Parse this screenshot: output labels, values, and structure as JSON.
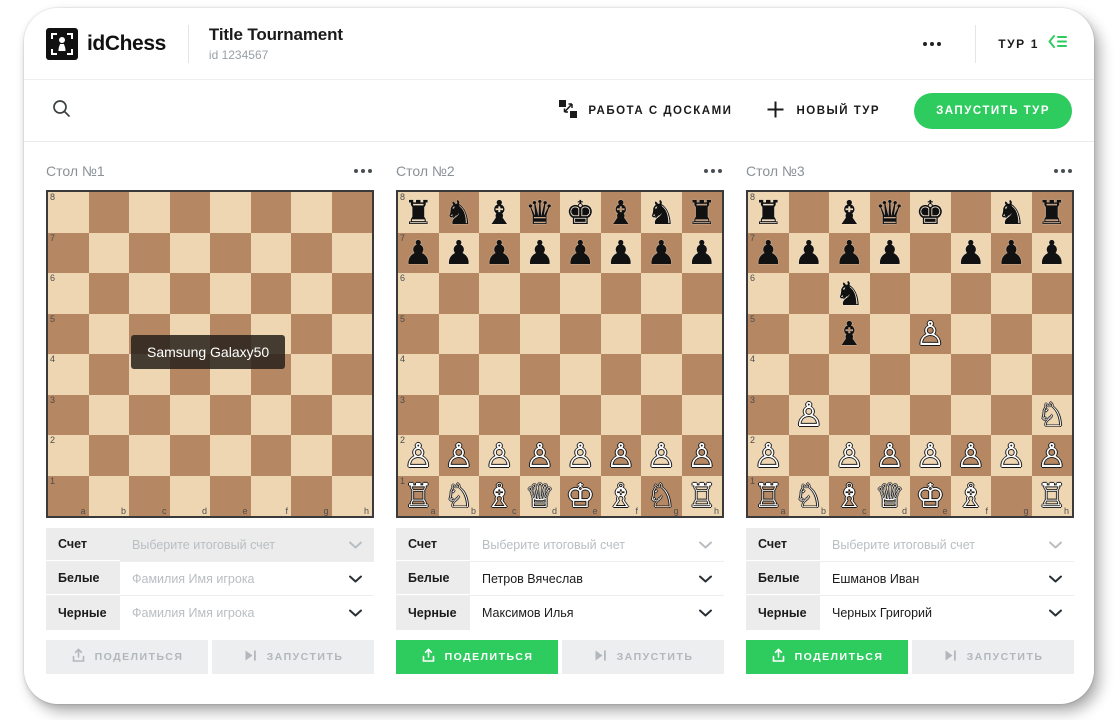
{
  "header": {
    "brand_name": "idChess",
    "brand_icon": "chess-pawn-logo-icon",
    "tournament_title": "Title Tournament",
    "tournament_id": "id 1234567",
    "more_icon": "more-horizontal-icon",
    "round_label": "ТУР 1",
    "round_icon": "round-list-icon"
  },
  "toolbar": {
    "search_icon": "search-icon",
    "boards_icon": "boards-work-icon",
    "boards_label": "РАБОТА С ДОСКАМИ",
    "plus_icon": "plus-icon",
    "new_round_label": "НОВЫЙ ТУР",
    "start_round_label": "ЗАПУСТИТЬ ТУР"
  },
  "colors": {
    "accent_green": "#2ecc5f",
    "board_light": "#eed6b3",
    "board_dark": "#b58863",
    "label_bg": "#ececec",
    "disabled_text": "#b2b7bb"
  },
  "labels": {
    "score": "Счет",
    "white": "Белые",
    "black": "Черные",
    "score_placeholder": "Выберите итоговый счет",
    "player_placeholder": "Фамилия Имя игрока",
    "share": "ПОДЕЛИТЬСЯ",
    "launch": "ЗАПУСТИТЬ",
    "share_icon": "share-upload-icon",
    "launch_icon": "play-to-end-icon",
    "chevron_icon": "chevron-down-icon",
    "more_icon": "more-horizontal-icon"
  },
  "board_coords": {
    "files": [
      "a",
      "b",
      "c",
      "d",
      "e",
      "f",
      "g",
      "h"
    ],
    "ranks": [
      "8",
      "7",
      "6",
      "5",
      "4",
      "3",
      "2",
      "1"
    ]
  },
  "cards": [
    {
      "title": "Стол №1",
      "tooltip": "Samsung Galaxy50",
      "score_value": "",
      "white_value": "",
      "black_value": "",
      "score_disabled": true,
      "share_enabled": false,
      "launch_enabled": false,
      "position": [
        [
          "",
          "",
          "",
          "",
          "",
          "",
          "",
          ""
        ],
        [
          "",
          "",
          "",
          "",
          "",
          "",
          "",
          ""
        ],
        [
          "",
          "",
          "",
          "",
          "",
          "",
          "",
          ""
        ],
        [
          "",
          "",
          "",
          "",
          "",
          "",
          "",
          ""
        ],
        [
          "",
          "",
          "",
          "",
          "",
          "",
          "",
          ""
        ],
        [
          "",
          "",
          "",
          "",
          "",
          "",
          "",
          ""
        ],
        [
          "",
          "",
          "",
          "",
          "",
          "",
          "",
          ""
        ],
        [
          "",
          "",
          "",
          "",
          "",
          "",
          "",
          ""
        ]
      ]
    },
    {
      "title": "Стол №2",
      "tooltip": null,
      "score_value": "",
      "white_value": "Петров Вячеслав",
      "black_value": "Максимов Илья",
      "score_disabled": false,
      "share_enabled": true,
      "launch_enabled": false,
      "position": [
        [
          "br",
          "bn",
          "bb",
          "bq",
          "bk",
          "bb",
          "bn",
          "br"
        ],
        [
          "bp",
          "bp",
          "bp",
          "bp",
          "bp",
          "bp",
          "bp",
          "bp"
        ],
        [
          "",
          "",
          "",
          "",
          "",
          "",
          "",
          ""
        ],
        [
          "",
          "",
          "",
          "",
          "",
          "",
          "",
          ""
        ],
        [
          "",
          "",
          "",
          "",
          "",
          "",
          "",
          ""
        ],
        [
          "",
          "",
          "",
          "",
          "",
          "",
          "",
          ""
        ],
        [
          "wp",
          "wp",
          "wp",
          "wp",
          "wp",
          "wp",
          "wp",
          "wp"
        ],
        [
          "wr",
          "wn",
          "wb",
          "wq",
          "wk",
          "wb",
          "wn",
          "wr"
        ]
      ]
    },
    {
      "title": "Стол №3",
      "tooltip": null,
      "score_value": "",
      "white_value": "Ешманов Иван",
      "black_value": "Черных Григорий",
      "score_disabled": false,
      "share_enabled": true,
      "launch_enabled": false,
      "position": [
        [
          "br",
          "",
          "bb",
          "bq",
          "bk",
          "",
          "bn",
          "br"
        ],
        [
          "bp",
          "bp",
          "bp",
          "bp",
          "",
          "bp",
          "bp",
          "bp"
        ],
        [
          "",
          "",
          "bn",
          "",
          "",
          "",
          "",
          ""
        ],
        [
          "",
          "",
          "bb",
          "",
          "wp",
          "",
          "",
          ""
        ],
        [
          "",
          "",
          "",
          "",
          "",
          "",
          "",
          ""
        ],
        [
          "",
          "wp",
          "",
          "",
          "",
          "",
          "",
          "wn"
        ],
        [
          "wp",
          "",
          "wp",
          "wp",
          "wp",
          "wp",
          "wp",
          "wp"
        ],
        [
          "wr",
          "wn",
          "wb",
          "wq",
          "wk",
          "wb",
          "",
          "wr"
        ]
      ]
    }
  ]
}
